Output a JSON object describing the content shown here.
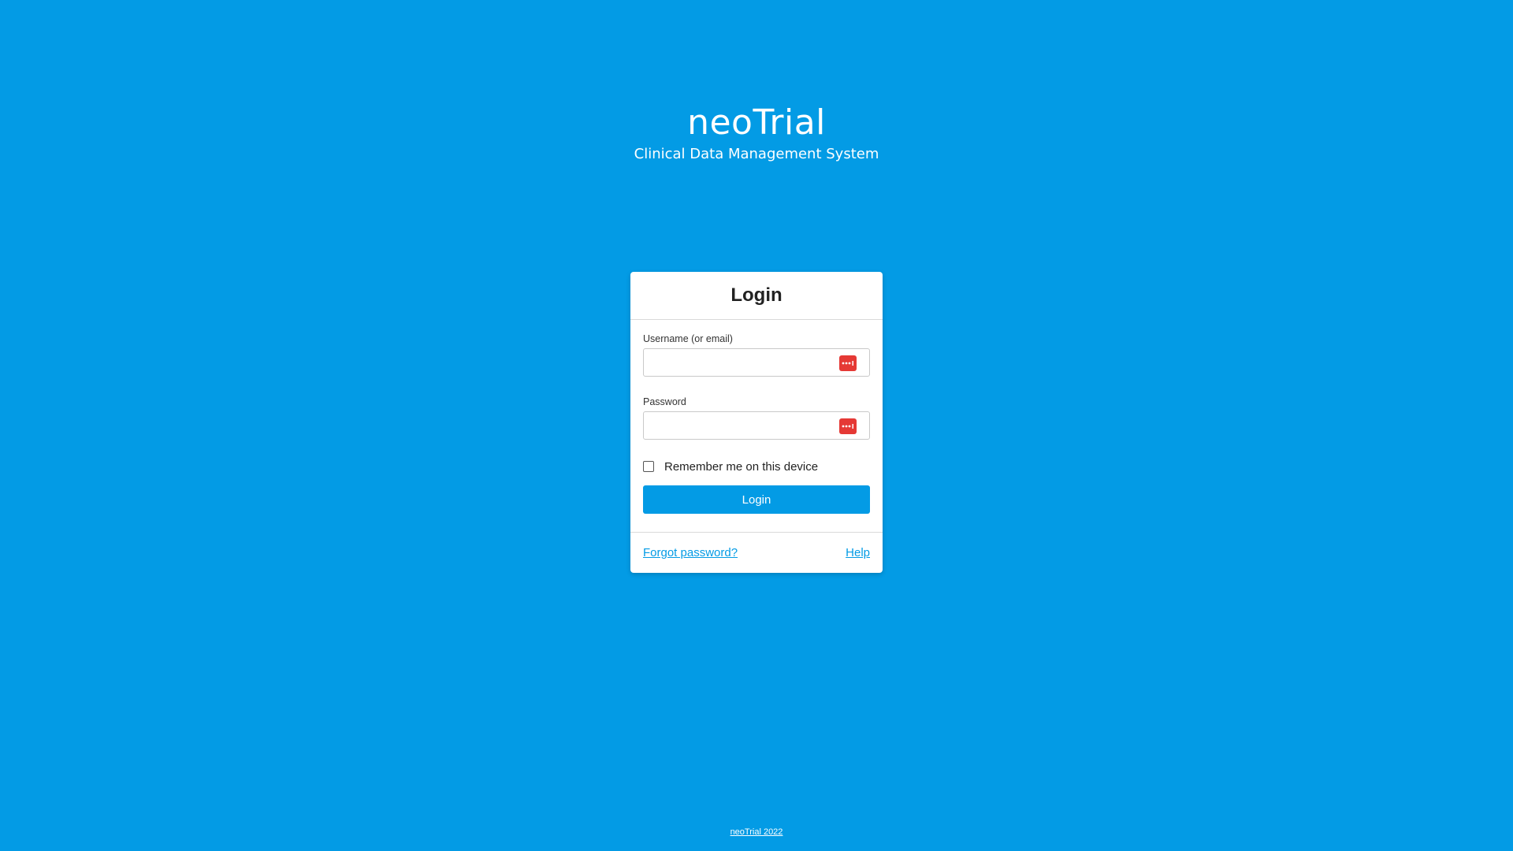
{
  "brand": {
    "name": "neoTrial",
    "subtitle": "Clinical Data Management System"
  },
  "login_card": {
    "title": "Login",
    "username": {
      "label": "Username (or email)",
      "value": "",
      "icon": "password-manager-icon"
    },
    "password": {
      "label": "Password",
      "value": "",
      "icon": "password-manager-icon"
    },
    "remember_label": "Remember me on this device",
    "remember_checked": false,
    "login_button": "Login",
    "forgot_link": "Forgot password?",
    "help_link": "Help"
  },
  "footer": {
    "copyright": "neoTrial 2022"
  },
  "colors": {
    "background": "#039be5",
    "accent": "#039be5",
    "icon_red": "#e53935"
  }
}
